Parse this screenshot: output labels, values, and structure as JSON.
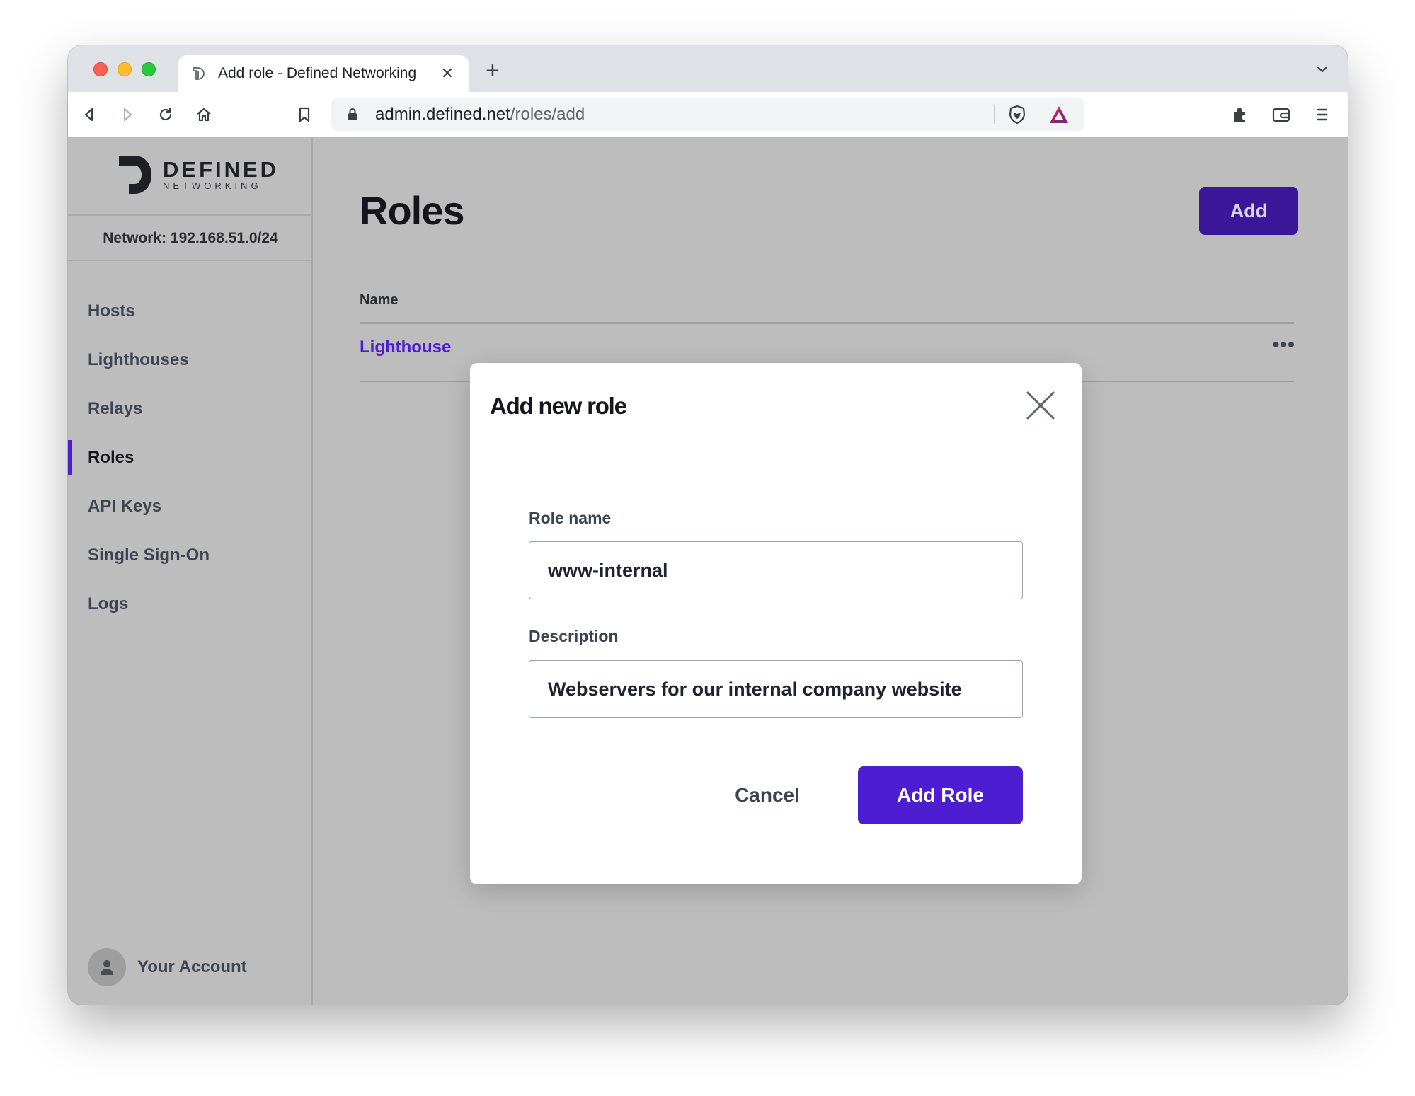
{
  "browser": {
    "tab_title": "Add role - Defined Networking",
    "tab_close_glyph": "✕",
    "new_tab_glyph": "+",
    "url_host": "admin.defined.net",
    "url_path": "/roles/add"
  },
  "sidebar": {
    "logo_main": "DEFINED",
    "logo_sub": "NETWORKING",
    "network_label": "Network: 192.168.51.0/24",
    "items": [
      {
        "label": "Hosts",
        "active": false
      },
      {
        "label": "Lighthouses",
        "active": false
      },
      {
        "label": "Relays",
        "active": false
      },
      {
        "label": "Roles",
        "active": true
      },
      {
        "label": "API Keys",
        "active": false
      },
      {
        "label": "Single Sign-On",
        "active": false
      },
      {
        "label": "Logs",
        "active": false
      }
    ],
    "account_label": "Your Account"
  },
  "main": {
    "title": "Roles",
    "add_label": "Add",
    "table_header_name": "Name",
    "row_link": "Lighthouse",
    "row_menu": "•••"
  },
  "modal": {
    "title": "Add new role",
    "role_name_label": "Role name",
    "role_name_value": "www-internal",
    "description_label": "Description",
    "description_value": "Webservers for our internal company website",
    "cancel_label": "Cancel",
    "submit_label": "Add Role"
  },
  "colors": {
    "accent": "#4d1ed1",
    "overlay_background": "#bdbdbd"
  }
}
